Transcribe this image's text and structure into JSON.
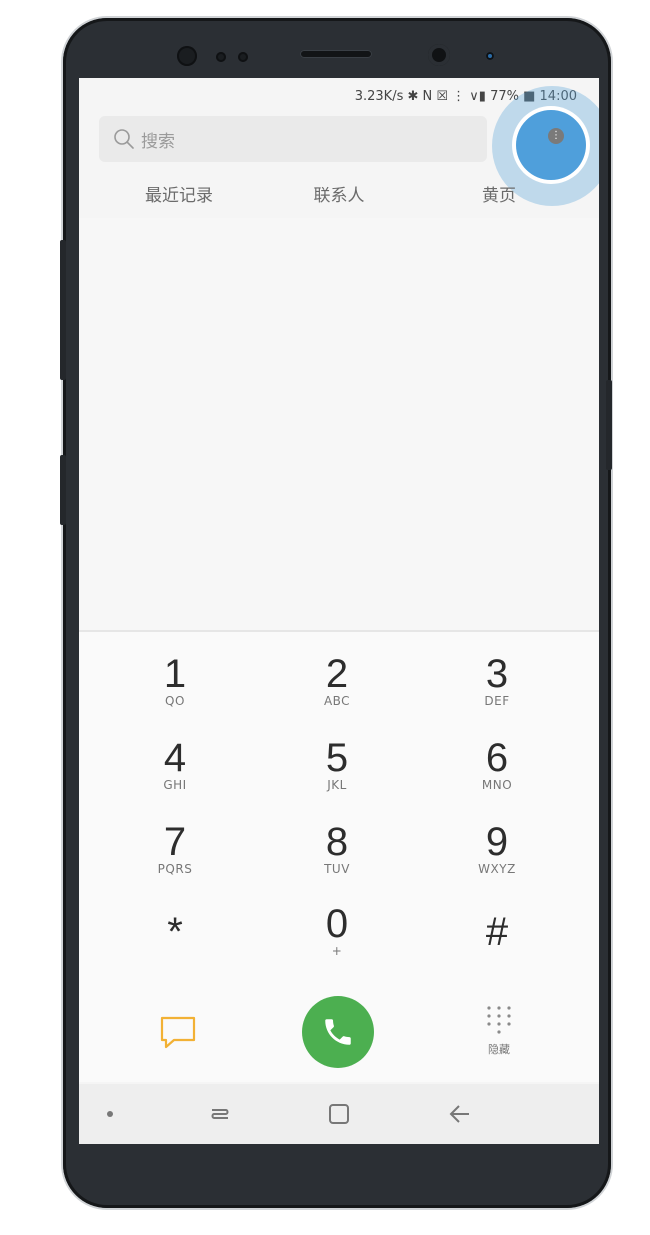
{
  "status_bar": {
    "text": "3.23K/s ✱ N ☒ ⋮ ∨▮ 77% ■ 14:00"
  },
  "search": {
    "placeholder": "搜索",
    "icon": "search-icon"
  },
  "tabs": [
    {
      "label": "最近记录"
    },
    {
      "label": "联系人"
    },
    {
      "label": "黄页"
    }
  ],
  "keypad": [
    {
      "num": "1",
      "letters": "QO"
    },
    {
      "num": "2",
      "letters": "ABC"
    },
    {
      "num": "3",
      "letters": "DEF"
    },
    {
      "num": "4",
      "letters": "GHI"
    },
    {
      "num": "5",
      "letters": "JKL"
    },
    {
      "num": "6",
      "letters": "MNO"
    },
    {
      "num": "7",
      "letters": "PQRS"
    },
    {
      "num": "8",
      "letters": "TUV"
    },
    {
      "num": "9",
      "letters": "WXYZ"
    },
    {
      "num": "*",
      "letters": ""
    },
    {
      "num": "0",
      "letters": "+"
    },
    {
      "num": "#",
      "letters": ""
    }
  ],
  "actions": {
    "hide_label": "隐藏"
  },
  "colors": {
    "accent_blue": "#4f9fdb",
    "call_green": "#4caf50",
    "chat_orange": "#f2b134"
  }
}
